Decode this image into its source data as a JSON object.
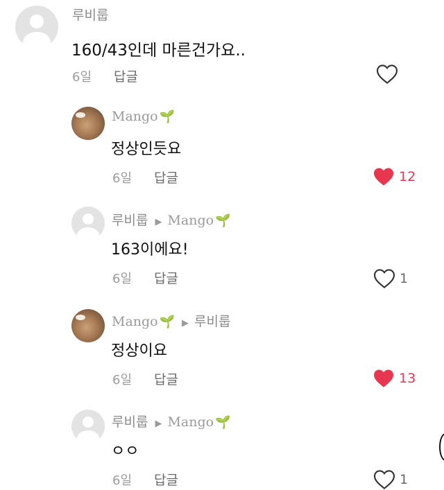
{
  "comments": [
    {
      "author": "루비룹",
      "reply_to": "",
      "text": "160/43인데 마른건가요..",
      "age": "6일",
      "reply_label": "답글",
      "liked": false,
      "like_count": ""
    },
    {
      "author": "Mango",
      "reply_to": "",
      "text": "정상인듯요",
      "age": "6일",
      "reply_label": "답글",
      "liked": true,
      "like_count": "12"
    },
    {
      "author": "루비룹",
      "reply_to": "Mango",
      "text": "163이에요!",
      "age": "6일",
      "reply_label": "답글",
      "liked": false,
      "like_count": "1"
    },
    {
      "author": "Mango",
      "reply_to": "루비룹",
      "text": "정상이요",
      "age": "6일",
      "reply_label": "답글",
      "liked": true,
      "like_count": "13"
    },
    {
      "author": "루비룹",
      "reply_to": "Mango",
      "text": "ㅇㅇ",
      "age": "6일",
      "reply_label": "답글",
      "liked": false,
      "like_count": "1"
    }
  ],
  "colors": {
    "like_active": "#e8364f",
    "author": "#8b8b8b",
    "text": "#111111",
    "sprout": "#3aa53a"
  },
  "icons": {
    "like": "heart-icon",
    "reply_arrow": "right-triangle-icon",
    "sprout": "sprout-icon"
  }
}
